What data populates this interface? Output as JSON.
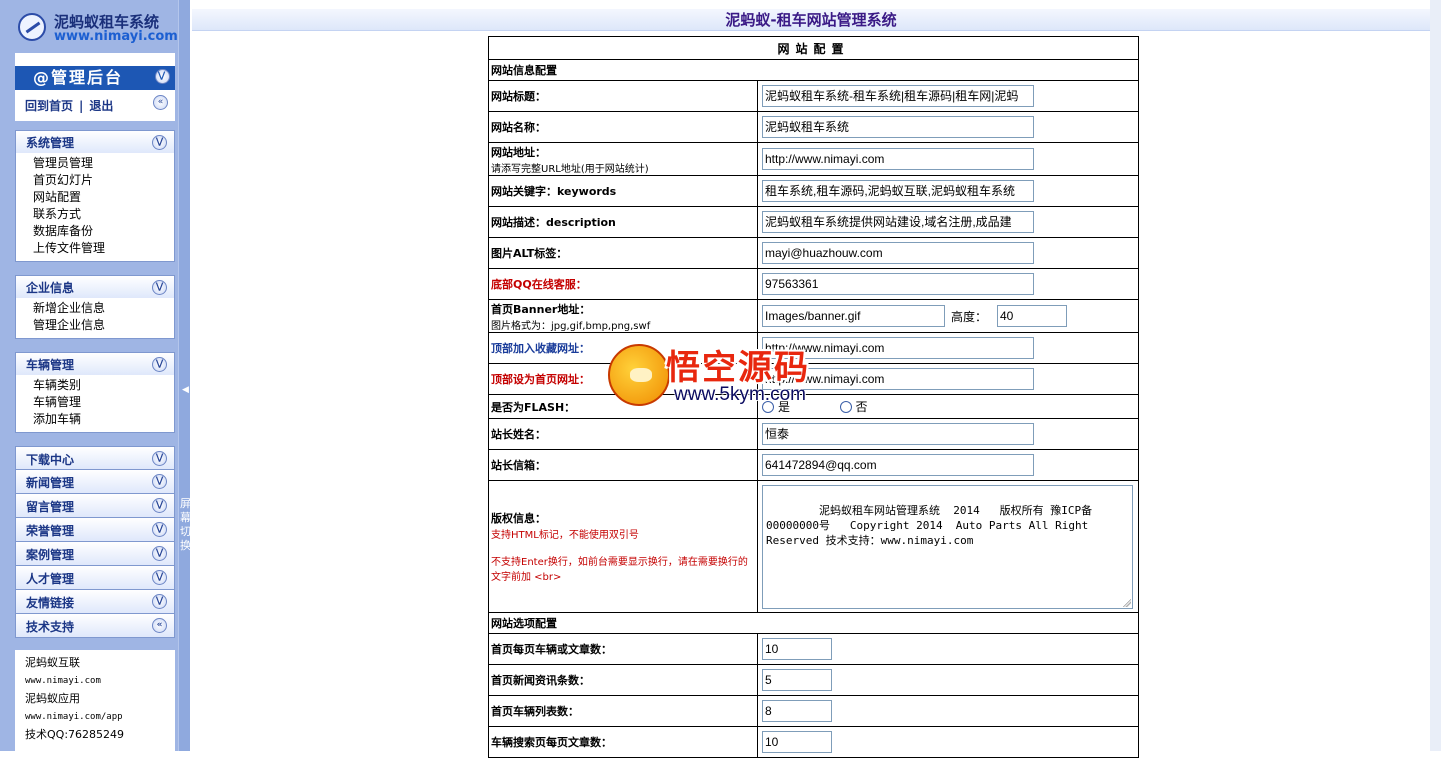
{
  "logo": {
    "name": "泥蚂蚁租车系统",
    "url": "www.nimayi.com"
  },
  "admin": {
    "title": "@管理后台",
    "home_link": "回到首页",
    "sep": "|",
    "logout_link": "退出"
  },
  "sidebar": {
    "system": {
      "title": "系统管理",
      "items": [
        "管理员管理",
        "首页幻灯片",
        "网站配置",
        "联系方式",
        "数据库备份",
        "上传文件管理"
      ]
    },
    "company": {
      "title": "企业信息",
      "items": [
        "新增企业信息",
        "管理企业信息"
      ]
    },
    "vehicle": {
      "title": "车辆管理",
      "items": [
        "车辆类别",
        "车辆管理",
        "添加车辆"
      ]
    },
    "collapsed": [
      "下载中心",
      "新闻管理",
      "留言管理",
      "荣誉管理",
      "案例管理",
      "人才管理",
      "友情链接",
      "技术支持"
    ],
    "links": [
      "泥蚂蚁互联",
      "www.nimayi.com",
      "泥蚂蚁应用",
      "www.nimayi.com/app",
      "技术QQ:76285249"
    ],
    "switch_label": "屏幕切换"
  },
  "header": {
    "title": "泥蚂蚁-租车网站管理系统"
  },
  "config": {
    "table_title": "网站配置",
    "section_info": "网站信息配置",
    "site_title": {
      "label": "网站标题：",
      "value": "泥蚂蚁租车系统-租车系统|租车源码|租车网|泥蚂"
    },
    "site_name": {
      "label": "网站名称：",
      "value": "泥蚂蚁租车系统"
    },
    "site_url": {
      "label": "网站地址：",
      "hint": "请添写完整URL地址(用于网站统计)",
      "value": "http://www.nimayi.com"
    },
    "keywords": {
      "label": "网站关键字：keywords",
      "value": "租车系统,租车源码,泥蚂蚁互联,泥蚂蚁租车系统"
    },
    "description": {
      "label": "网站描述：description",
      "value": "泥蚂蚁租车系统提供网站建设,域名注册,成品建"
    },
    "alt": {
      "label": "图片ALT标签：",
      "value": "mayi@huazhouw.com"
    },
    "qq": {
      "label": "底部QQ在线客服：",
      "value": "97563361"
    },
    "banner": {
      "label": "首页Banner地址：",
      "hint": "图片格式为：jpg,gif,bmp,png,swf",
      "value": "Images/banner.gif",
      "height_label": "高度：",
      "height_value": "40"
    },
    "fav": {
      "label": "顶部加入收藏网址：",
      "value": "http://www.nimayi.com"
    },
    "homepage": {
      "label": "顶部设为首页网址：",
      "value": "http://www.nimayi.com"
    },
    "flash": {
      "label": "是否为FLASH：",
      "yes": "是",
      "no": "否"
    },
    "owner": {
      "label": "站长姓名：",
      "value": "恒泰"
    },
    "email": {
      "label": "站长信箱：",
      "value": "641472894@qq.com"
    },
    "copyright": {
      "label": "版权信息：",
      "hint1": "支持HTML标记，不能使用双引号",
      "hint2": "不支持Enter换行，如前台需要显示换行，请在需要换行的文字前加 <br>",
      "value": "泥蚂蚁租车网站管理系统  2014   版权所有 豫ICP备00000000号   Copyright 2014  Auto Parts All Right Reserved 技术支持：www.nimayi.com"
    },
    "section_options": "网站选项配置",
    "home_count": {
      "label": "首页每页车辆或文章数：",
      "value": "10"
    },
    "news_count": {
      "label": "首页新闻资讯条数：",
      "value": "5"
    },
    "car_count": {
      "label": "首页车辆列表数：",
      "value": "8"
    },
    "search_count": {
      "label": "车辆搜索页每页文章数：",
      "value": "10"
    }
  },
  "watermark": {
    "title": "悟空源码",
    "url": "www.5kym.com"
  }
}
